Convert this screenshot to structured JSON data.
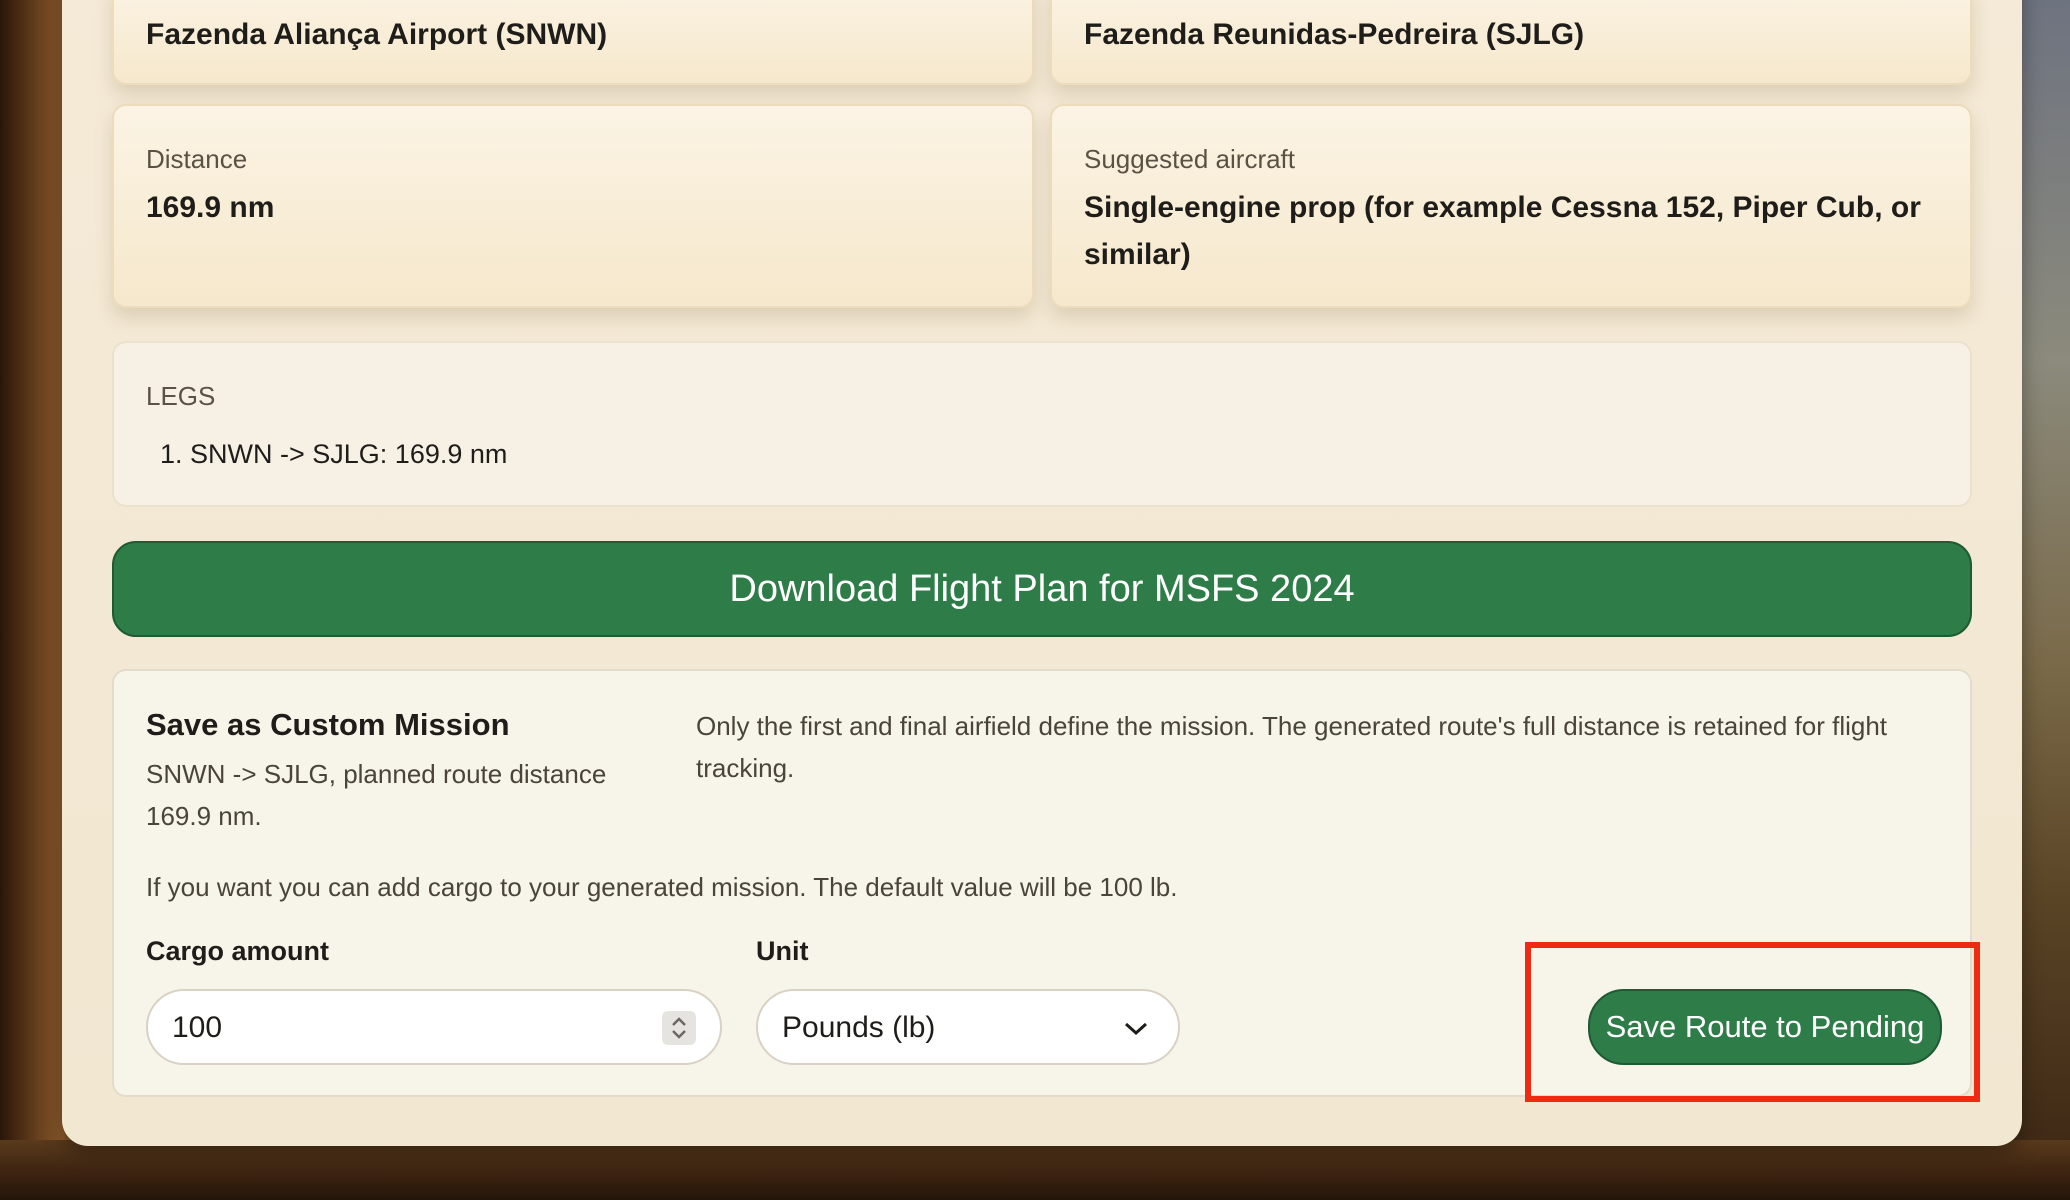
{
  "route": {
    "origin": "Fazenda Aliança Airport (SNWN)",
    "destination": "Fazenda Reunidas-Pedreira (SJLG)"
  },
  "distance": {
    "label": "Distance",
    "value": "169.9 nm"
  },
  "aircraft": {
    "label": "Suggested aircraft",
    "value": "Single-engine prop (for example Cessna 152, Piper Cub, or similar)"
  },
  "legs": {
    "label": "LEGS",
    "items": [
      "1. SNWN -> SJLG: 169.9 nm"
    ]
  },
  "download_button": "Download Flight Plan for MSFS 2024",
  "mission": {
    "title": "Save as Custom Mission",
    "summary": "SNWN -> SJLG, planned route distance 169.9 nm.",
    "note": "Only the first and final airfield define the mission. The generated route's full distance is retained for flight tracking.",
    "cargo_hint": "If you want you can add cargo to your generated mission. The default value will be 100 lb.",
    "cargo_label": "Cargo amount",
    "cargo_value": "100",
    "unit_label": "Unit",
    "unit_selected": "Pounds (lb)",
    "save_button": "Save Route to Pending"
  },
  "colors": {
    "accent_green": "#2e7d48",
    "highlight_red": "#f02a12"
  }
}
